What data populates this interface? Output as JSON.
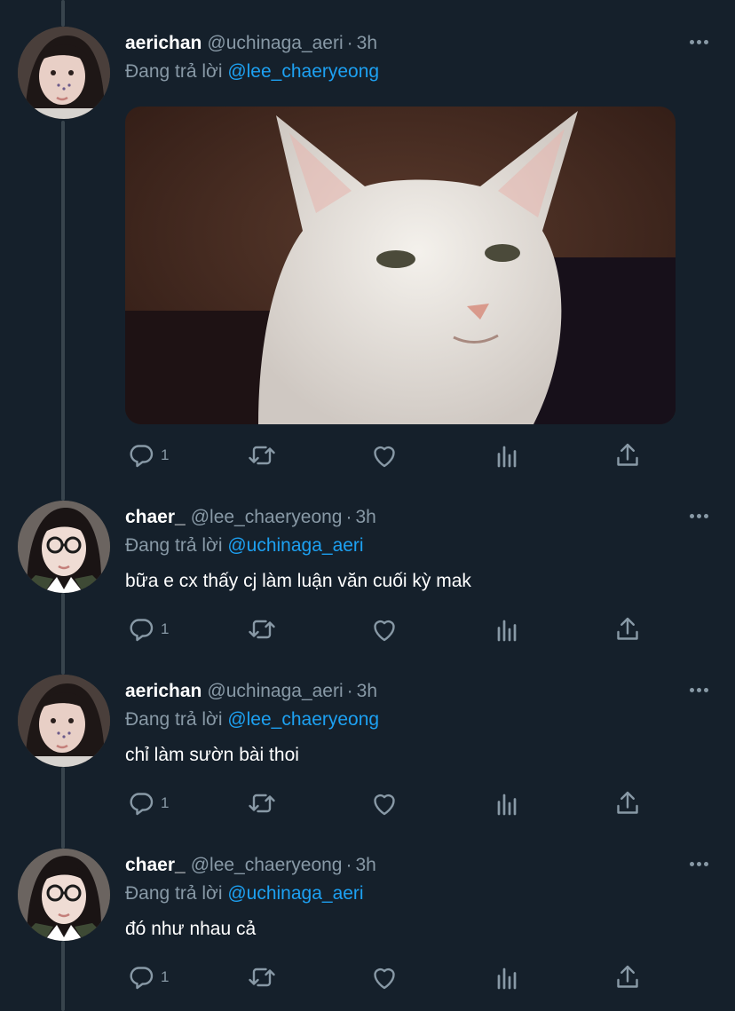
{
  "tweets": [
    {
      "name": "aerichan",
      "handle": "@uchinaga_aeri",
      "dot": "·",
      "time": "3h",
      "replying_prefix": "Đang trả lời",
      "replying_to": "@lee_chaeryeong",
      "text": "",
      "reply_count": "1",
      "has_media": true
    },
    {
      "name": "chaer_",
      "handle": "@lee_chaeryeong",
      "dot": "·",
      "time": "3h",
      "replying_prefix": "Đang trả lời",
      "replying_to": "@uchinaga_aeri",
      "text": "bữa e cx thấy cj làm luận văn cuối kỳ mak",
      "reply_count": "1",
      "has_media": false
    },
    {
      "name": "aerichan",
      "handle": "@uchinaga_aeri",
      "dot": "·",
      "time": "3h",
      "replying_prefix": "Đang trả lời",
      "replying_to": "@lee_chaeryeong",
      "text": "chỉ làm sườn bài thoi",
      "reply_count": "1",
      "has_media": false
    },
    {
      "name": "chaer_",
      "handle": "@lee_chaeryeong",
      "dot": "·",
      "time": "3h",
      "replying_prefix": "Đang trả lời",
      "replying_to": "@uchinaga_aeri",
      "text": "đó như nhau cả",
      "reply_count": "1",
      "has_media": false
    }
  ],
  "icons": {
    "more": "more-icon",
    "reply": "reply-icon",
    "retweet": "retweet-icon",
    "like": "heart-icon",
    "analytics": "analytics-icon",
    "share": "share-icon"
  },
  "colors": {
    "background": "#15202b",
    "muted": "#8899a6",
    "link": "#1da1f2",
    "thread_line": "#38444d"
  }
}
